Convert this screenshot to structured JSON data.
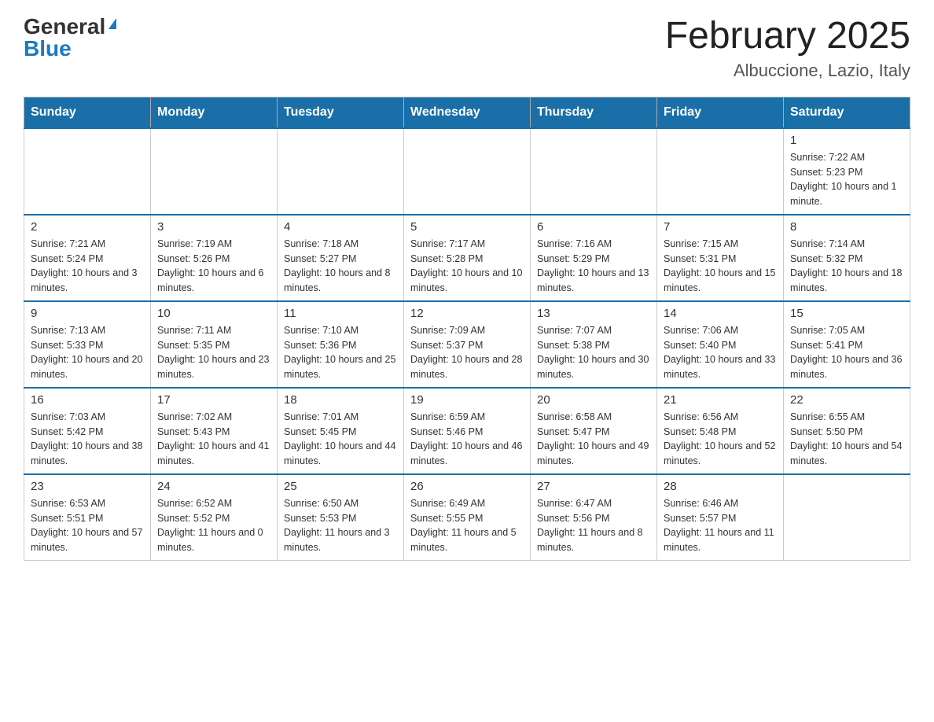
{
  "header": {
    "logo": {
      "general": "General",
      "blue": "Blue",
      "tagline": ""
    },
    "title": "February 2025",
    "location": "Albuccione, Lazio, Italy"
  },
  "days_of_week": [
    "Sunday",
    "Monday",
    "Tuesday",
    "Wednesday",
    "Thursday",
    "Friday",
    "Saturday"
  ],
  "weeks": [
    [
      {
        "day": "",
        "info": ""
      },
      {
        "day": "",
        "info": ""
      },
      {
        "day": "",
        "info": ""
      },
      {
        "day": "",
        "info": ""
      },
      {
        "day": "",
        "info": ""
      },
      {
        "day": "",
        "info": ""
      },
      {
        "day": "1",
        "info": "Sunrise: 7:22 AM\nSunset: 5:23 PM\nDaylight: 10 hours and 1 minute."
      }
    ],
    [
      {
        "day": "2",
        "info": "Sunrise: 7:21 AM\nSunset: 5:24 PM\nDaylight: 10 hours and 3 minutes."
      },
      {
        "day": "3",
        "info": "Sunrise: 7:19 AM\nSunset: 5:26 PM\nDaylight: 10 hours and 6 minutes."
      },
      {
        "day": "4",
        "info": "Sunrise: 7:18 AM\nSunset: 5:27 PM\nDaylight: 10 hours and 8 minutes."
      },
      {
        "day": "5",
        "info": "Sunrise: 7:17 AM\nSunset: 5:28 PM\nDaylight: 10 hours and 10 minutes."
      },
      {
        "day": "6",
        "info": "Sunrise: 7:16 AM\nSunset: 5:29 PM\nDaylight: 10 hours and 13 minutes."
      },
      {
        "day": "7",
        "info": "Sunrise: 7:15 AM\nSunset: 5:31 PM\nDaylight: 10 hours and 15 minutes."
      },
      {
        "day": "8",
        "info": "Sunrise: 7:14 AM\nSunset: 5:32 PM\nDaylight: 10 hours and 18 minutes."
      }
    ],
    [
      {
        "day": "9",
        "info": "Sunrise: 7:13 AM\nSunset: 5:33 PM\nDaylight: 10 hours and 20 minutes."
      },
      {
        "day": "10",
        "info": "Sunrise: 7:11 AM\nSunset: 5:35 PM\nDaylight: 10 hours and 23 minutes."
      },
      {
        "day": "11",
        "info": "Sunrise: 7:10 AM\nSunset: 5:36 PM\nDaylight: 10 hours and 25 minutes."
      },
      {
        "day": "12",
        "info": "Sunrise: 7:09 AM\nSunset: 5:37 PM\nDaylight: 10 hours and 28 minutes."
      },
      {
        "day": "13",
        "info": "Sunrise: 7:07 AM\nSunset: 5:38 PM\nDaylight: 10 hours and 30 minutes."
      },
      {
        "day": "14",
        "info": "Sunrise: 7:06 AM\nSunset: 5:40 PM\nDaylight: 10 hours and 33 minutes."
      },
      {
        "day": "15",
        "info": "Sunrise: 7:05 AM\nSunset: 5:41 PM\nDaylight: 10 hours and 36 minutes."
      }
    ],
    [
      {
        "day": "16",
        "info": "Sunrise: 7:03 AM\nSunset: 5:42 PM\nDaylight: 10 hours and 38 minutes."
      },
      {
        "day": "17",
        "info": "Sunrise: 7:02 AM\nSunset: 5:43 PM\nDaylight: 10 hours and 41 minutes."
      },
      {
        "day": "18",
        "info": "Sunrise: 7:01 AM\nSunset: 5:45 PM\nDaylight: 10 hours and 44 minutes."
      },
      {
        "day": "19",
        "info": "Sunrise: 6:59 AM\nSunset: 5:46 PM\nDaylight: 10 hours and 46 minutes."
      },
      {
        "day": "20",
        "info": "Sunrise: 6:58 AM\nSunset: 5:47 PM\nDaylight: 10 hours and 49 minutes."
      },
      {
        "day": "21",
        "info": "Sunrise: 6:56 AM\nSunset: 5:48 PM\nDaylight: 10 hours and 52 minutes."
      },
      {
        "day": "22",
        "info": "Sunrise: 6:55 AM\nSunset: 5:50 PM\nDaylight: 10 hours and 54 minutes."
      }
    ],
    [
      {
        "day": "23",
        "info": "Sunrise: 6:53 AM\nSunset: 5:51 PM\nDaylight: 10 hours and 57 minutes."
      },
      {
        "day": "24",
        "info": "Sunrise: 6:52 AM\nSunset: 5:52 PM\nDaylight: 11 hours and 0 minutes."
      },
      {
        "day": "25",
        "info": "Sunrise: 6:50 AM\nSunset: 5:53 PM\nDaylight: 11 hours and 3 minutes."
      },
      {
        "day": "26",
        "info": "Sunrise: 6:49 AM\nSunset: 5:55 PM\nDaylight: 11 hours and 5 minutes."
      },
      {
        "day": "27",
        "info": "Sunrise: 6:47 AM\nSunset: 5:56 PM\nDaylight: 11 hours and 8 minutes."
      },
      {
        "day": "28",
        "info": "Sunrise: 6:46 AM\nSunset: 5:57 PM\nDaylight: 11 hours and 11 minutes."
      },
      {
        "day": "",
        "info": ""
      }
    ]
  ]
}
